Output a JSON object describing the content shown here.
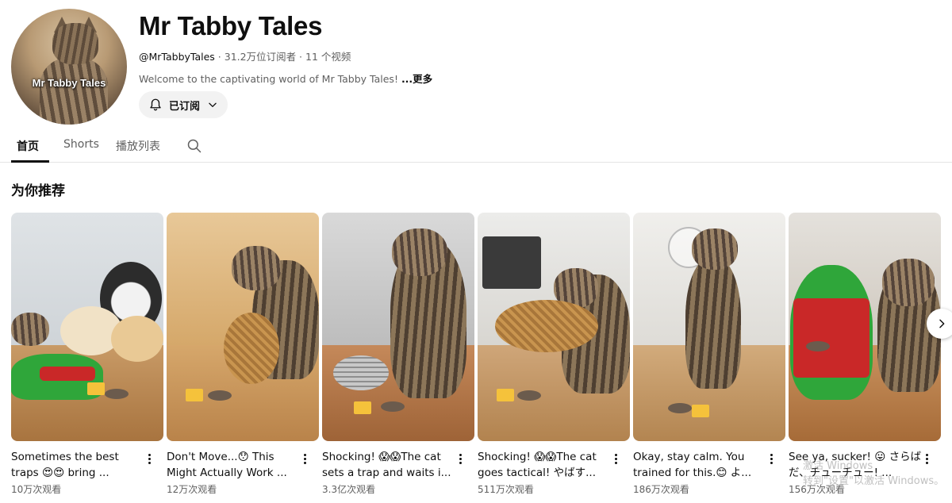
{
  "channel": {
    "name": "Mr Tabby Tales",
    "avatar_text": "Mr Tabby Tales",
    "handle": "@MrTabbyTales",
    "stats": " · 31.2万位订阅者 · 11 个视频",
    "description": "Welcome to the captivating world of Mr Tabby Tales! ",
    "more_label": "...更多",
    "subscribe_label": "已订阅"
  },
  "tabs": [
    {
      "label": "首页",
      "active": true
    },
    {
      "label": "Shorts",
      "active": false
    },
    {
      "label": "播放列表",
      "active": false
    }
  ],
  "section": {
    "title": "为你推荐"
  },
  "videos": [
    {
      "title": "Sometimes the best traps 😍😍 bring ...",
      "views": "10万次观看"
    },
    {
      "title": "Don't Move...😯 This Might Actually Work ...",
      "views": "12万次观看"
    },
    {
      "title": "Shocking! 😱😱The cat sets a trap and waits i...",
      "views": "3.3亿次观看"
    },
    {
      "title": "Shocking! 😱😱The cat goes tactical! やばす...",
      "views": "511万次观看"
    },
    {
      "title": "Okay, stay calm. You trained for this.😊 よ...",
      "views": "186万次观看"
    },
    {
      "title": "See ya, sucker! 😛 さらばだ、チューチュー! ...",
      "views": "156万次观看"
    }
  ],
  "watermark": {
    "line1": "激活 Windows",
    "line2": "转到\"设置\"以激活 Windows。"
  },
  "icons": {
    "bell": "bell-icon",
    "chevron": "chevron-down-icon",
    "search": "search-icon",
    "kebab": "more-vert-icon",
    "next": "chevron-right-icon"
  }
}
